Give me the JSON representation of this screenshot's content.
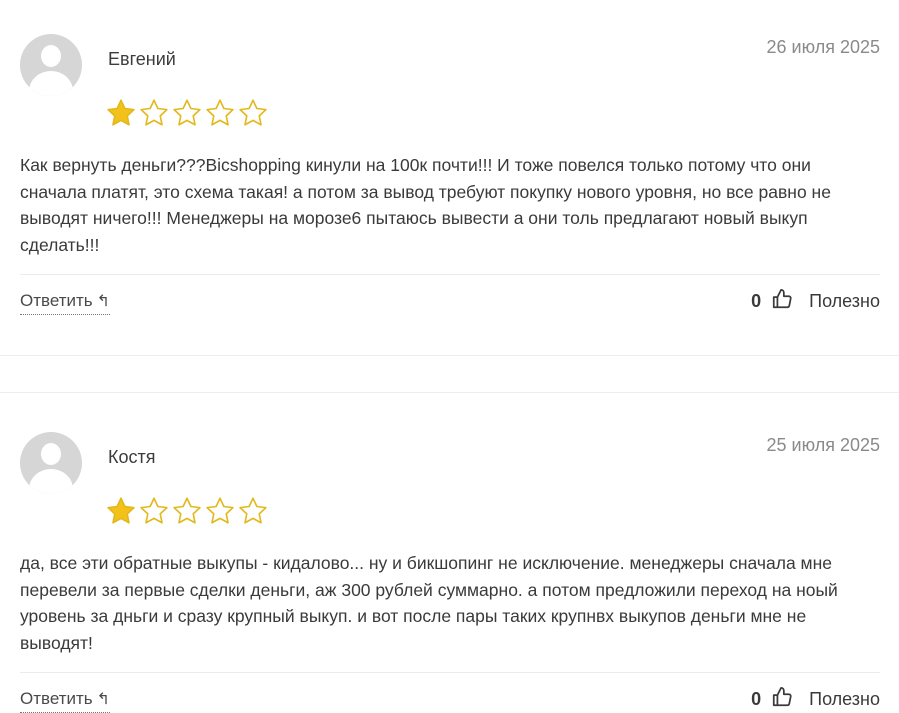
{
  "reviews": [
    {
      "author": "Евгений",
      "date": "26 июля 2025",
      "rating": 1,
      "text": "Как вернуть деньги???Bicshopping кинули на 100к почти!!! И тоже повелся только потому что они сначала платят, это схема такая! а потом за вывод требуют покупку нового уровня, но все равно не выводят ничего!!! Менеджеры на морозе6 пытаюсь вывести а они толь предлагают новый выкуп сделать!!!",
      "reply_label": "Ответить",
      "useful_count": "0",
      "useful_label": "Полезно"
    },
    {
      "author": "Костя",
      "date": "25 июля 2025",
      "rating": 1,
      "text": "да, все эти обратные выкупы - кидалово... ну и бикшопинг не исключение. менеджеры сначала мне перевели за первые сделки деньги, аж 300 рублей суммарно. а потом предложили переход на ноый уровень за дньги и сразу крупный выкуп. и вот после пары таких крупнвх выкупов деньги мне не выводят!",
      "reply_label": "Ответить",
      "useful_count": "0",
      "useful_label": "Полезно"
    }
  ],
  "icons": {
    "avatar": "user-avatar-icon",
    "star": "star-icon",
    "reply_arrow": "reply-arrow-icon",
    "thumb": "thumbs-up-icon"
  },
  "colors": {
    "star_filled": "#f2c21b",
    "star_outline": "#e3b81c",
    "date": "#8a8a8a",
    "text": "#3a3a3a"
  }
}
